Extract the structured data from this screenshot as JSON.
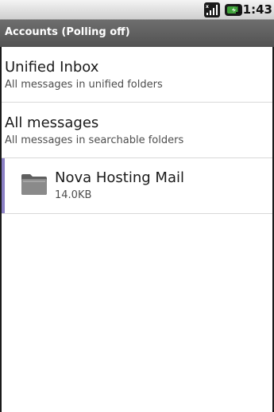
{
  "status_bar": {
    "time": "11:43",
    "signal_icon": "signal-strength-icon",
    "battery_icon": "battery-icon"
  },
  "title_bar": {
    "title": "Accounts (Polling off)"
  },
  "list": {
    "unified_inbox": {
      "title": "Unified Inbox",
      "subtitle": "All messages in unified folders"
    },
    "all_messages": {
      "title": "All messages",
      "subtitle": "All messages in searchable folders"
    },
    "account": {
      "name": "Nova Hosting Mail",
      "size": "14.0KB",
      "icon": "folder-icon",
      "color": "#8b80c4"
    }
  }
}
